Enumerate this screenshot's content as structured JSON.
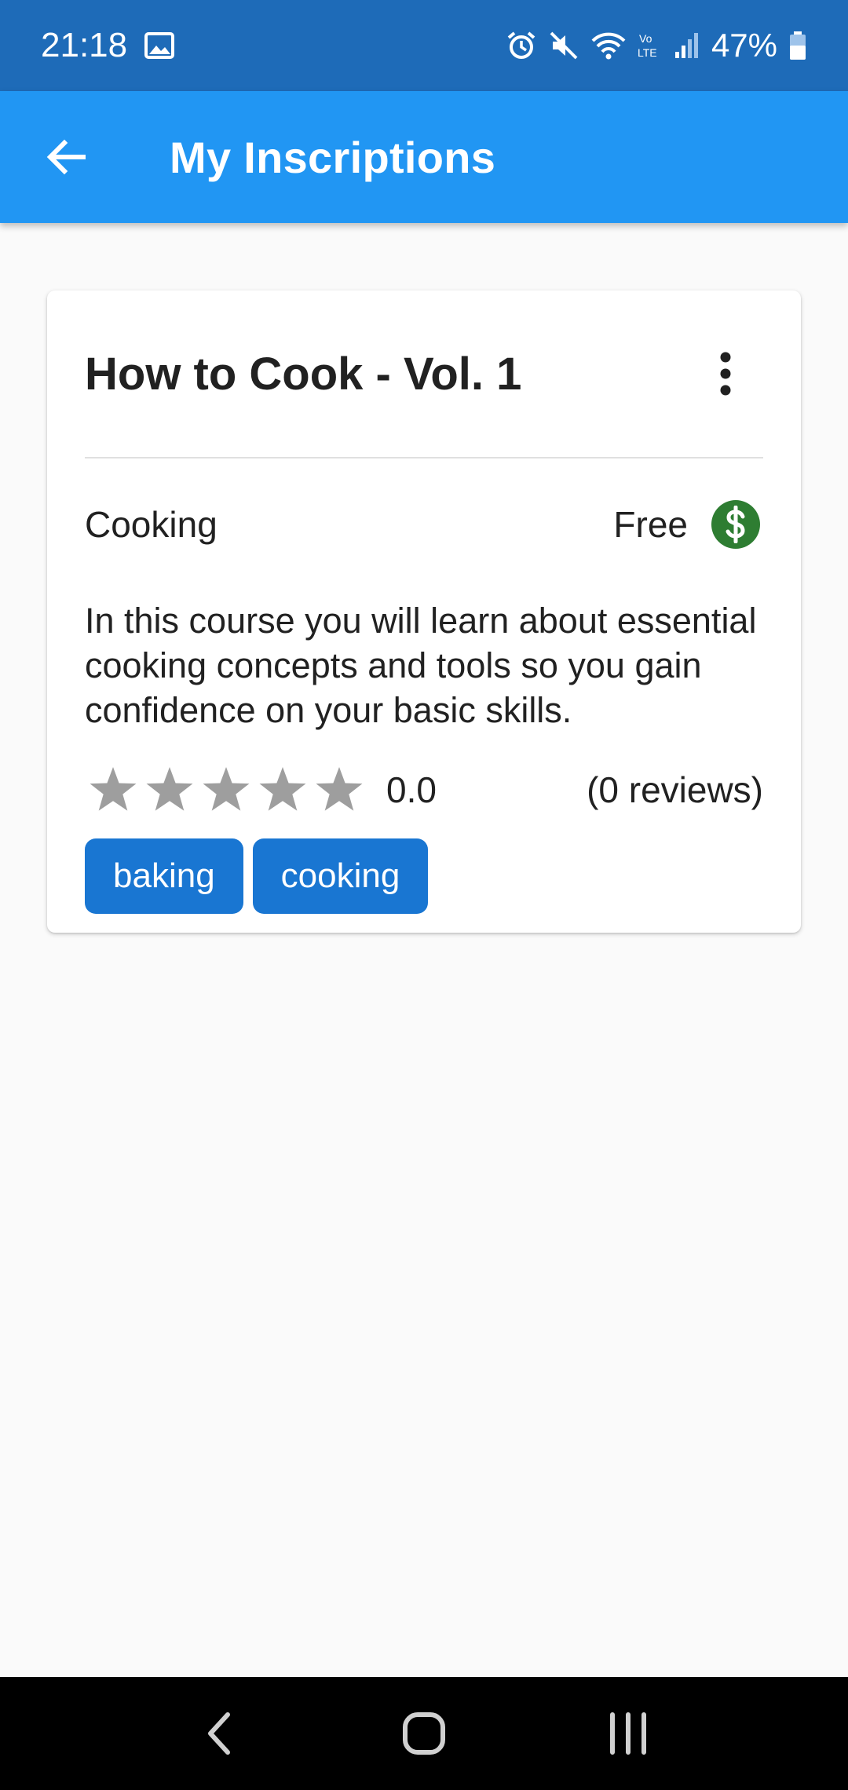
{
  "status_bar": {
    "time": "21:18",
    "battery": "47%",
    "icons": [
      "image-icon",
      "alarm-icon",
      "mute-icon",
      "wifi-icon",
      "volte-icon",
      "signal-icon",
      "battery-icon"
    ]
  },
  "app_bar": {
    "title": "My Inscriptions",
    "back_icon": "arrow-back-icon"
  },
  "course": {
    "title": "How to Cook - Vol. 1",
    "category": "Cooking",
    "price": "Free",
    "price_icon": "dollar-icon",
    "description": "In this course you will learn about essential cooking concepts and tools so you gain confidence on your basic skills.",
    "rating": "0.0",
    "stars_filled": 0,
    "stars_total": 5,
    "reviews": "(0 reviews)",
    "tags": [
      "baking",
      "cooking"
    ]
  },
  "colors": {
    "status_bar": "#1e6bb8",
    "app_bar": "#2196f3",
    "tag": "#1976d2",
    "dollar_badge": "#2e7d32",
    "star_empty": "#9e9e9e"
  },
  "nav_bar": {
    "icons": [
      "nav-back-icon",
      "nav-home-icon",
      "nav-recents-icon"
    ]
  }
}
